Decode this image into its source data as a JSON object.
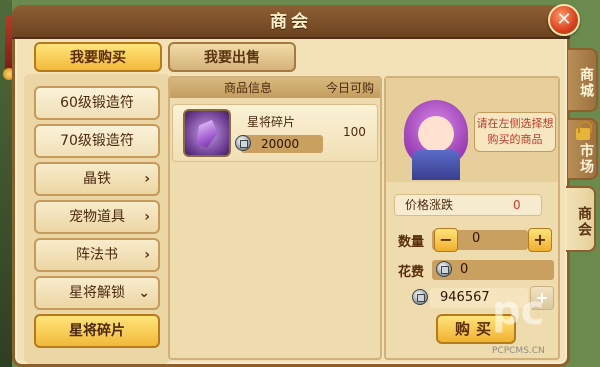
{
  "window": {
    "title": "商会",
    "close_label": "✕"
  },
  "tabs": {
    "buy_label": "我要购买",
    "sell_label": "我要出售"
  },
  "side_tabs": [
    {
      "label": "商城"
    },
    {
      "label": "市场"
    },
    {
      "label": "商会"
    }
  ],
  "categories": [
    {
      "label": "60级锻造符",
      "has_arrow": false
    },
    {
      "label": "70级锻造符",
      "has_arrow": false
    },
    {
      "label": "晶铁",
      "arrow": "›"
    },
    {
      "label": "宠物道具",
      "arrow": "›"
    },
    {
      "label": "阵法书",
      "arrow": "›"
    },
    {
      "label": "星将解锁",
      "arrow": "⌄"
    },
    {
      "label": "星将碎片",
      "selected": true
    }
  ],
  "goods": {
    "header_info": "商品信息",
    "header_today": "今日可购",
    "items": [
      {
        "name": "星将碎片",
        "price": "20000",
        "today_qty": "100",
        "icon": "purple-crystal-icon"
      }
    ]
  },
  "trade": {
    "hint": "请在左侧选择想购买的商品",
    "price_change_label": "价格涨跌",
    "price_change_value": "0",
    "quantity_label": "数量",
    "minus_label": "−",
    "plus_label": "+",
    "quantity_value": "0",
    "cost_label": "花费",
    "cost_value": "0",
    "balance_value": "946567",
    "balance_plus_label": "+",
    "buy_label": "购买"
  },
  "watermark": {
    "logo": "pc",
    "site": "PCPCMS.CN"
  },
  "colors": {
    "accent": "#f2b93a",
    "frame": "#8d5f2c",
    "price_up": "#d23a2a"
  }
}
